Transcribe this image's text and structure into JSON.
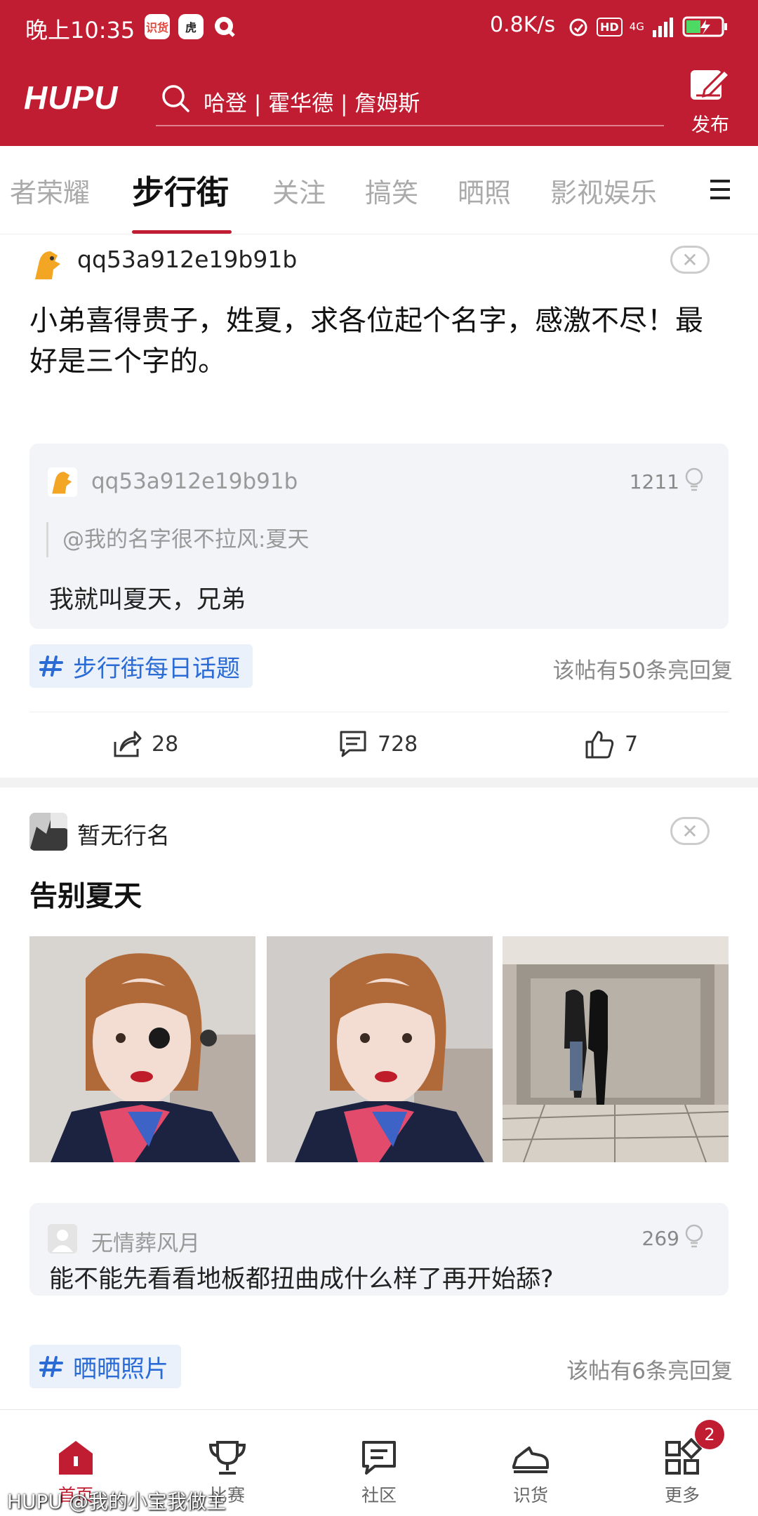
{
  "status_bar": {
    "time": "晚上10:35",
    "app_icon_1": "识货",
    "app_icon_2": "虎",
    "net_speed": "0.8K/s",
    "hd": "HD",
    "network": "4G",
    "icons": [
      "alarm-icon",
      "hd-icon",
      "signal-icon",
      "battery-charging-icon"
    ]
  },
  "header": {
    "logo": "HUPU",
    "search_placeholder": "哈登 | 霍华德 | 詹姆斯",
    "publish_label": "发布",
    "accent": "#c11d32"
  },
  "tabs": {
    "items": [
      "者荣耀",
      "步行街",
      "关注",
      "搞笑",
      "晒照",
      "影视娱乐"
    ],
    "active": "步行街"
  },
  "posts": [
    {
      "username": "qq53a912e19b91b",
      "title": "小弟喜得贵子，姓夏，求各位起个名字，感激不尽！最好是三个字的。",
      "reply": {
        "user": "qq53a912e19b91b",
        "likes": "1211",
        "quote": "@我的名字很不拉风:夏天",
        "text": "我就叫夏天，兄弟"
      },
      "topic": "步行街每日话题",
      "highlight_replies": "该帖有50条亮回复",
      "shares": "28",
      "comments": "728",
      "likes": "7"
    },
    {
      "username": "暂无行名",
      "title": "告别夏天",
      "reply": {
        "user": "无情葬风月",
        "likes": "269",
        "text": "能不能先看看地板都扭曲成什么样了再开始舔?"
      },
      "topic": "晒晒照片",
      "highlight_replies": "该帖有6条亮回复"
    }
  ],
  "bottom_nav": {
    "items": [
      "首页",
      "比赛",
      "社区",
      "识货",
      "更多"
    ],
    "active": "首页",
    "more_badge": "2"
  },
  "watermark": "HUPU @我的小宝我做主"
}
